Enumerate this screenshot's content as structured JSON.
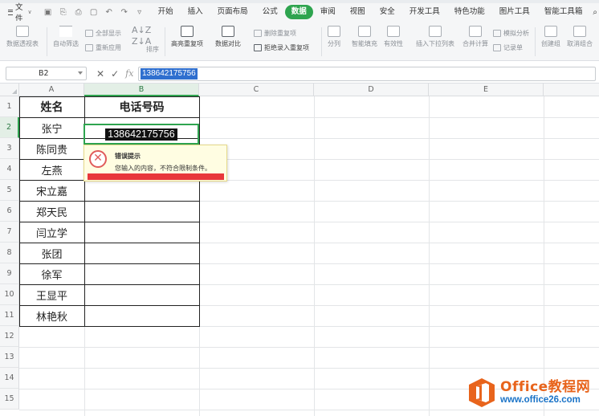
{
  "menu": {
    "file_label": "文件",
    "tabs": [
      "开始",
      "插入",
      "页面布局",
      "公式",
      "数据",
      "审阅",
      "视图",
      "安全",
      "开发工具",
      "特色功能",
      "图片工具",
      "智能工具箱"
    ],
    "active_tab": "数据",
    "search_label": "查找"
  },
  "ribbon": {
    "pivot": "数据透视表",
    "autofilter": "自动筛选",
    "show_all": "全部显示",
    "reapply": "重新应用",
    "sort": "排序",
    "highlight_dup": "高亮重复项",
    "compare": "数据对比",
    "remove_dup": "删除重复项",
    "reject_dup": "拒绝录入重复项",
    "split": "分列",
    "smart_fill": "智能填充",
    "validity": "有效性",
    "insert_dropdown": "插入下拉列表",
    "consolidate": "合并计算",
    "simulate": "模拟分析",
    "record": "记录单",
    "create_group": "创建组",
    "ungroup": "取消组合"
  },
  "formula_bar": {
    "cell_ref": "B2",
    "value": "138642175756"
  },
  "sheet": {
    "columns": [
      "A",
      "B",
      "C",
      "D",
      "E"
    ],
    "rows": [
      "1",
      "2",
      "3",
      "4",
      "5",
      "6",
      "7",
      "8",
      "9",
      "10",
      "11",
      "12",
      "13",
      "14",
      "15"
    ],
    "header_name": "姓名",
    "header_phone": "电话号码",
    "names": [
      "张宁",
      "陈同贵",
      "左燕",
      "宋立嘉",
      "郑天民",
      "闫立学",
      "张团",
      "徐军",
      "王显平",
      "林艳秋"
    ],
    "b2_value": "138642175756"
  },
  "error_tip": {
    "title": "错误提示",
    "message": "您输入的内容，不符合限制条件。"
  },
  "watermark": {
    "title": "Office教程网",
    "url": "www.office26.com"
  },
  "colors": {
    "accent_green": "#2ea44f",
    "selection_blue": "#2f6fcf",
    "error_red": "#e8373b",
    "brand_orange": "#e8641c"
  }
}
